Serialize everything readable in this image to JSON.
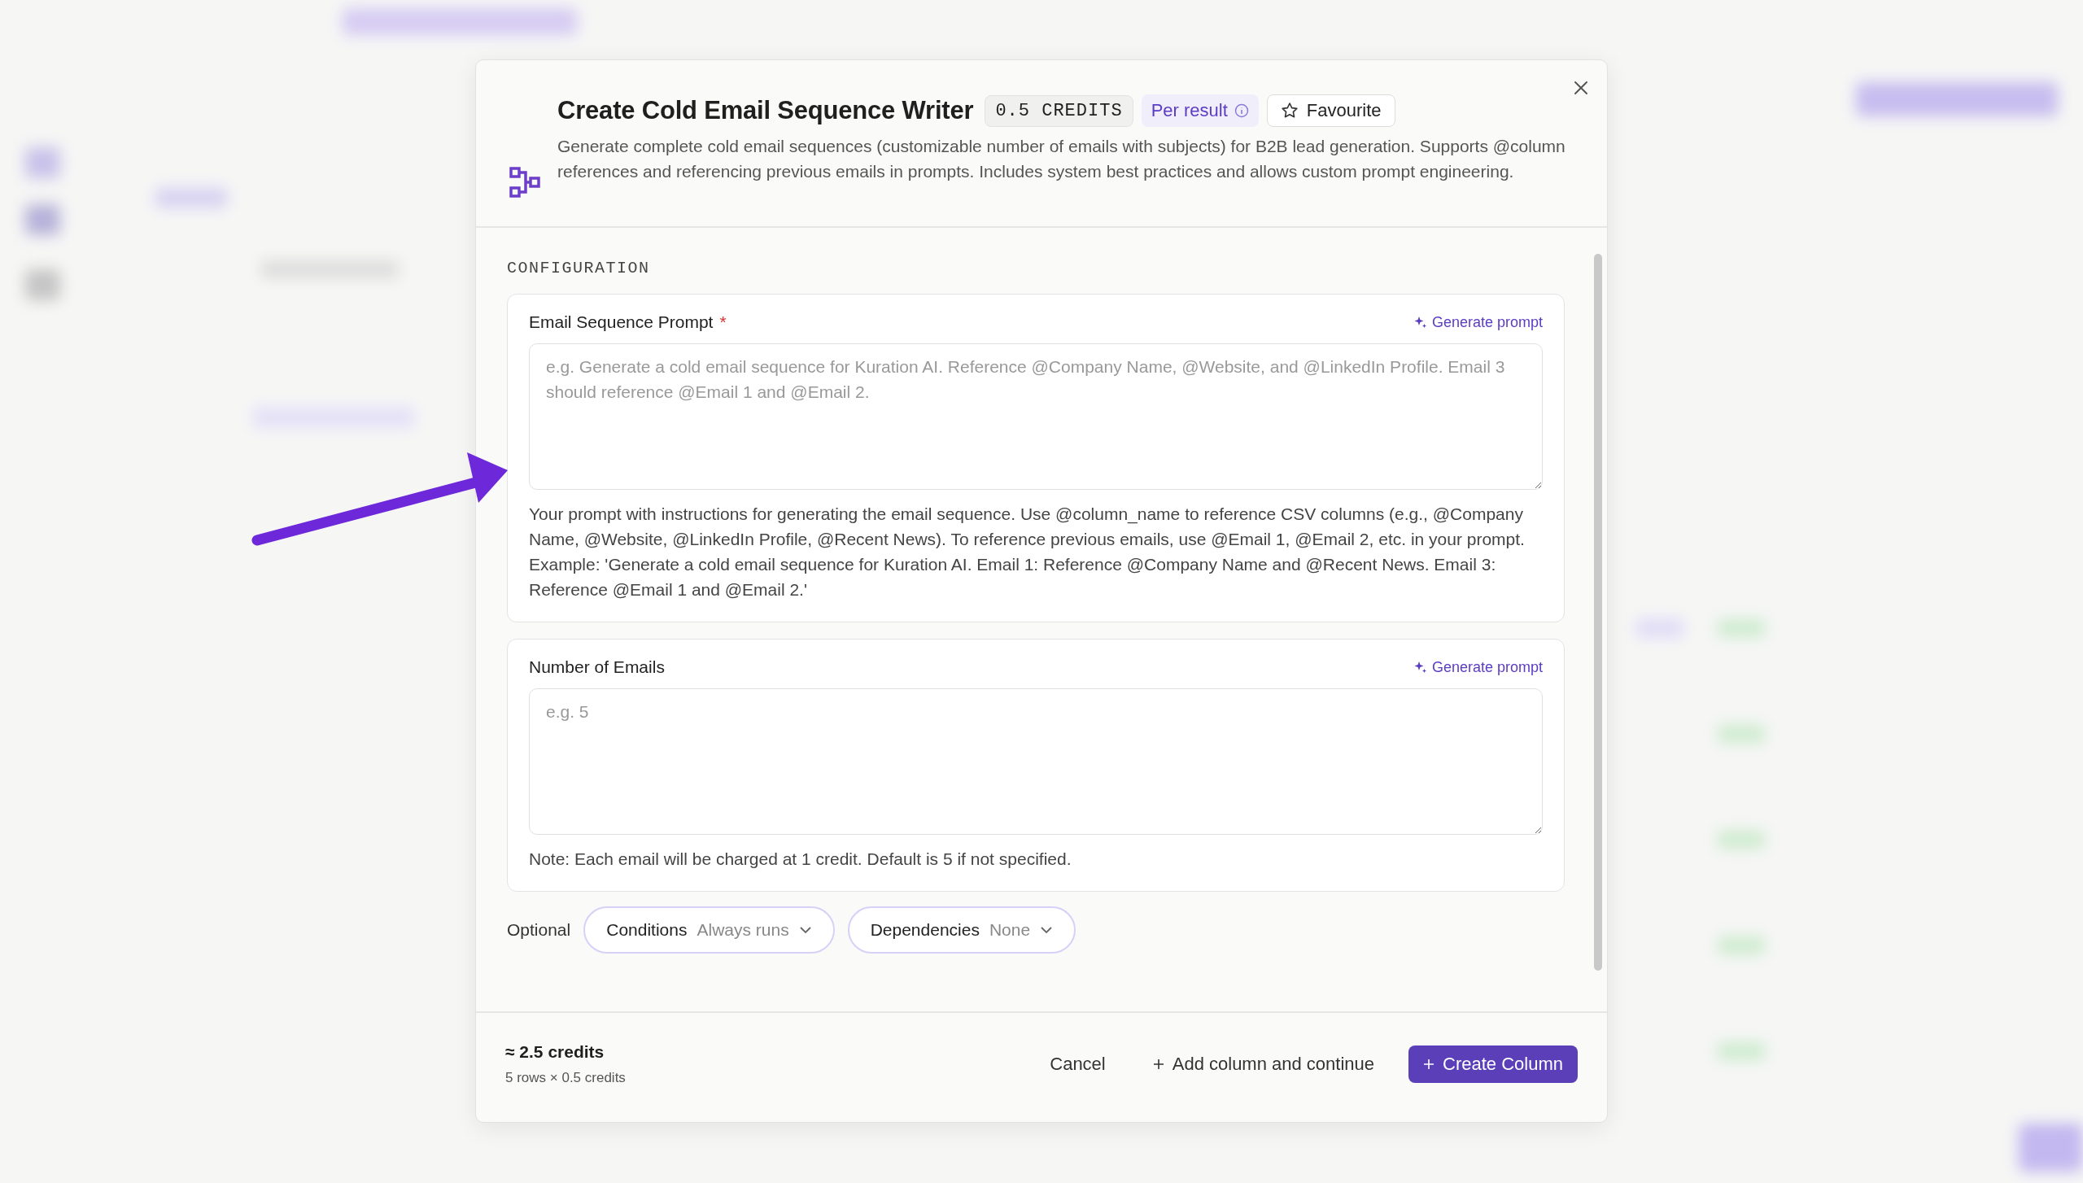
{
  "dialog": {
    "title": "Create Cold Email Sequence Writer",
    "credits_badge": "0.5 CREDITS",
    "pricing_badge": "Per result",
    "favourite_button": {
      "label": "Favourite",
      "selected": false
    },
    "description": "Generate complete cold email sequences (customizable number of emails with subjects) for B2B lead generation. Supports @column references and referencing previous emails in prompts. Includes system best practices and allows custom prompt engineering."
  },
  "configuration": {
    "heading": "CONFIGURATION",
    "fields": [
      {
        "label": "Email Sequence Prompt",
        "required_mark": "*",
        "generate_label": "Generate prompt",
        "placeholder": "e.g. Generate a cold email sequence for Kuration AI. Reference @Company Name, @Website, and @LinkedIn Profile. Email 3 should reference @Email 1 and @Email 2.",
        "help": "Your prompt with instructions for generating the email sequence. Use @column_name to reference CSV columns (e.g., @Company Name, @Website, @LinkedIn Profile, @Recent News). To reference previous emails, use @Email 1, @Email 2, etc. in your prompt. Example: 'Generate a cold email sequence for Kuration AI. Email 1: Reference @Company Name and @Recent News. Email 3: Reference @Email 1 and @Email 2.'"
      },
      {
        "label": "Number of Emails",
        "generate_label": "Generate prompt",
        "placeholder": "e.g. 5",
        "help": "Note: Each email will be charged at 1 credit. Default is 5 if not specified."
      }
    ]
  },
  "optional": {
    "label": "Optional",
    "selectors": [
      {
        "label": "Conditions",
        "value": "Always runs"
      },
      {
        "label": "Dependencies",
        "value": "None"
      }
    ]
  },
  "footer": {
    "estimate": "≈ 2.5 credits",
    "breakdown": "5 rows × 0.5 credits",
    "buttons": [
      {
        "label": "Cancel",
        "kind": "text"
      },
      {
        "label": "Add column and continue",
        "kind": "add"
      },
      {
        "label": "Create Column",
        "kind": "primary"
      }
    ]
  }
}
